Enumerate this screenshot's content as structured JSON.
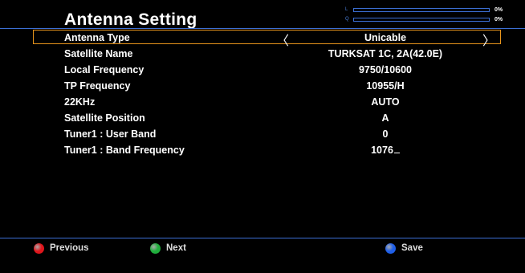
{
  "header": {
    "title": "Antenna Setting",
    "meters": [
      {
        "label": "L",
        "percent_text": "0%"
      },
      {
        "label": "Q",
        "percent_text": "0%"
      }
    ]
  },
  "settings": [
    {
      "label": "Antenna Type",
      "value": "Unicable",
      "selected": true
    },
    {
      "label": "Satellite Name",
      "value": "TURKSAT 1C, 2A(42.0E)"
    },
    {
      "label": "Local Frequency",
      "value": "9750/10600"
    },
    {
      "label": "TP Frequency",
      "value": "10955/H"
    },
    {
      "label": "22KHz",
      "value": "AUTO"
    },
    {
      "label": "Satellite Position",
      "value": "A"
    },
    {
      "label": "Tuner1 : User Band",
      "value": "0"
    },
    {
      "label": "Tuner1 : Band Frequency",
      "value": "1076"
    }
  ],
  "footer": {
    "previous": {
      "label": "Previous",
      "color": "#e0161c"
    },
    "next": {
      "label": "Next",
      "color": "#1fae3c"
    },
    "save": {
      "label": "Save",
      "color": "#1f5fe8"
    }
  },
  "colors": {
    "accent_line": "#3b6fd4",
    "selection_border": "#e8951c"
  }
}
